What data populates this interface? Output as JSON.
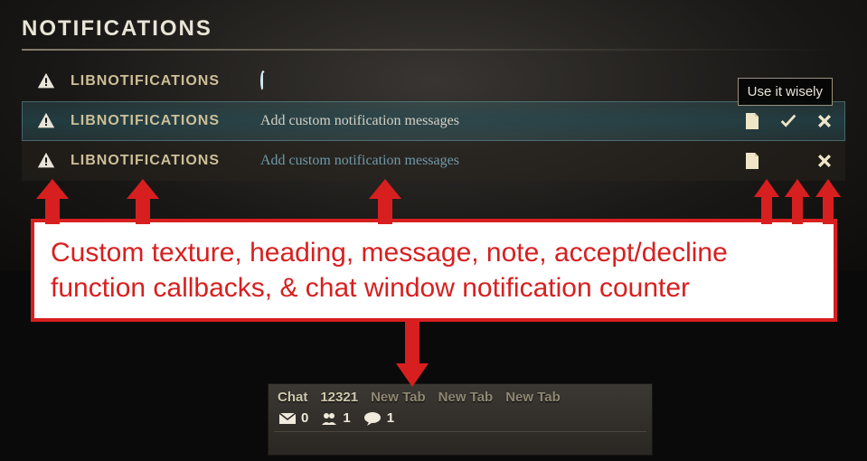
{
  "title": "NOTIFICATIONS",
  "tooltip": "Use it wisely",
  "rows": [
    {
      "heading": "LIBNOTIFICATIONS",
      "message": "",
      "loading": true
    },
    {
      "heading": "LIBNOTIFICATIONS",
      "message": "Add custom notification messages",
      "selected": true,
      "note": true,
      "accept": true,
      "decline": true
    },
    {
      "heading": "LIBNOTIFICATIONS",
      "message": "Add custom notification messages",
      "note": true,
      "decline": true
    }
  ],
  "annotation": "Custom texture, heading, message, note, accept/decline function callbacks, & chat window notification counter",
  "chat": {
    "tabs": [
      "Chat",
      "12321",
      "New Tab",
      "New Tab",
      "New Tab"
    ],
    "mail": 0,
    "friends": 1,
    "notifications": 1
  }
}
